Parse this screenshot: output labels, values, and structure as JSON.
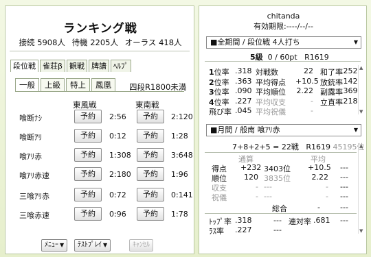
{
  "title": "ランキング戦",
  "stats": {
    "online": "接続 5908人",
    "waiting": "待機 2205人",
    "allclass": "オーラス 418人"
  },
  "tabs": [
    "段位戦",
    "雀荘β",
    "観戦",
    "牌譜",
    "ﾍﾙﾌﾟ"
  ],
  "subtabs": [
    "一般",
    "上級",
    "特上",
    "鳳凰"
  ],
  "condition": "四段R1800未満",
  "col_east": "東風戦",
  "col_south": "東南戦",
  "reserve_label": "予約",
  "rules": [
    {
      "label": "喰断ﾅｼ",
      "east": "2:56",
      "south": "2:120"
    },
    {
      "label": "喰断ｱﾘ",
      "east": "0:12",
      "south": "1:28"
    },
    {
      "label": "喰ｱﾘ赤",
      "east": "1:308",
      "south": "3:648"
    },
    {
      "label": "喰ｱﾘ赤速",
      "east": "2:180",
      "south": "1:96"
    },
    {
      "label": "三喰ｱﾘ赤",
      "east": "0:72",
      "south": "0:141"
    },
    {
      "label": "三喰赤速",
      "east": "0:96",
      "south": "1:78"
    }
  ],
  "bottom": {
    "menu": "ﾒﾆｭｰ",
    "test": "ﾃｽﾄﾌﾟﾚｲ",
    "cancel": "ｷｬﾝｾﾙ"
  },
  "user": "chitanda",
  "expiry": "有効期限:----/--/--",
  "period_select": "■全期間 / 段位戦 4人打ち",
  "rank_line": {
    "rank": "5級",
    "pt": "0 / 60pt",
    "rate": "R1619"
  },
  "left_stats": [
    {
      "k": "1位率",
      "v": ".318",
      "k2": "対戦数",
      "v2": "22",
      "k3": "和了率",
      "v3": ".252"
    },
    {
      "k": "2位率",
      "v": ".363",
      "k2": "平均得点",
      "v2": "+10.5",
      "k3": "放銃率",
      "v3": ".142"
    },
    {
      "k": "3位率",
      "v": ".090",
      "k2": "平均順位",
      "v2": "2.22",
      "k3": "副露率",
      "v3": ".369"
    },
    {
      "k": "4位率",
      "v": ".227",
      "k2": "平均収支",
      "v2": "-",
      "k3": "立直率",
      "v3": ".218"
    },
    {
      "k": "飛び率",
      "v": ".045",
      "k2": "平均祝儀",
      "v2": "-",
      "k3": "",
      "v3": ""
    }
  ],
  "month_select": "■月間 / 般南 喰ｱﾘ赤",
  "month_summary": {
    "formula": "7+8+2+5 = 22戦",
    "rate": "R1619",
    "rank": "45195位"
  },
  "month_headers": {
    "total": "通算",
    "avg": "平均"
  },
  "month_rows": [
    {
      "k": "得点",
      "a": "+232",
      "b": "3403位",
      "c": "+10.5",
      "d": "---"
    },
    {
      "k": "順位",
      "a": "120",
      "b": "3835位",
      "c": "2.22",
      "d": "---"
    },
    {
      "k": "収支",
      "a": "-",
      "b": "---",
      "c": "-",
      "d": "---"
    },
    {
      "k": "祝儀",
      "a": "-",
      "b": "---",
      "c": "-",
      "d": "---"
    }
  ],
  "overall": {
    "label": "総合",
    "v": "-",
    "v2": "---"
  },
  "top_rate": {
    "k": "ﾄｯﾌﾟ率",
    "v": ".318",
    "r": "---",
    "k2": "連対率",
    "v2": ".681",
    "r2": "---"
  },
  "last_rate": {
    "k": "ﾗｽ率",
    "v": ".227",
    "r": "---"
  }
}
